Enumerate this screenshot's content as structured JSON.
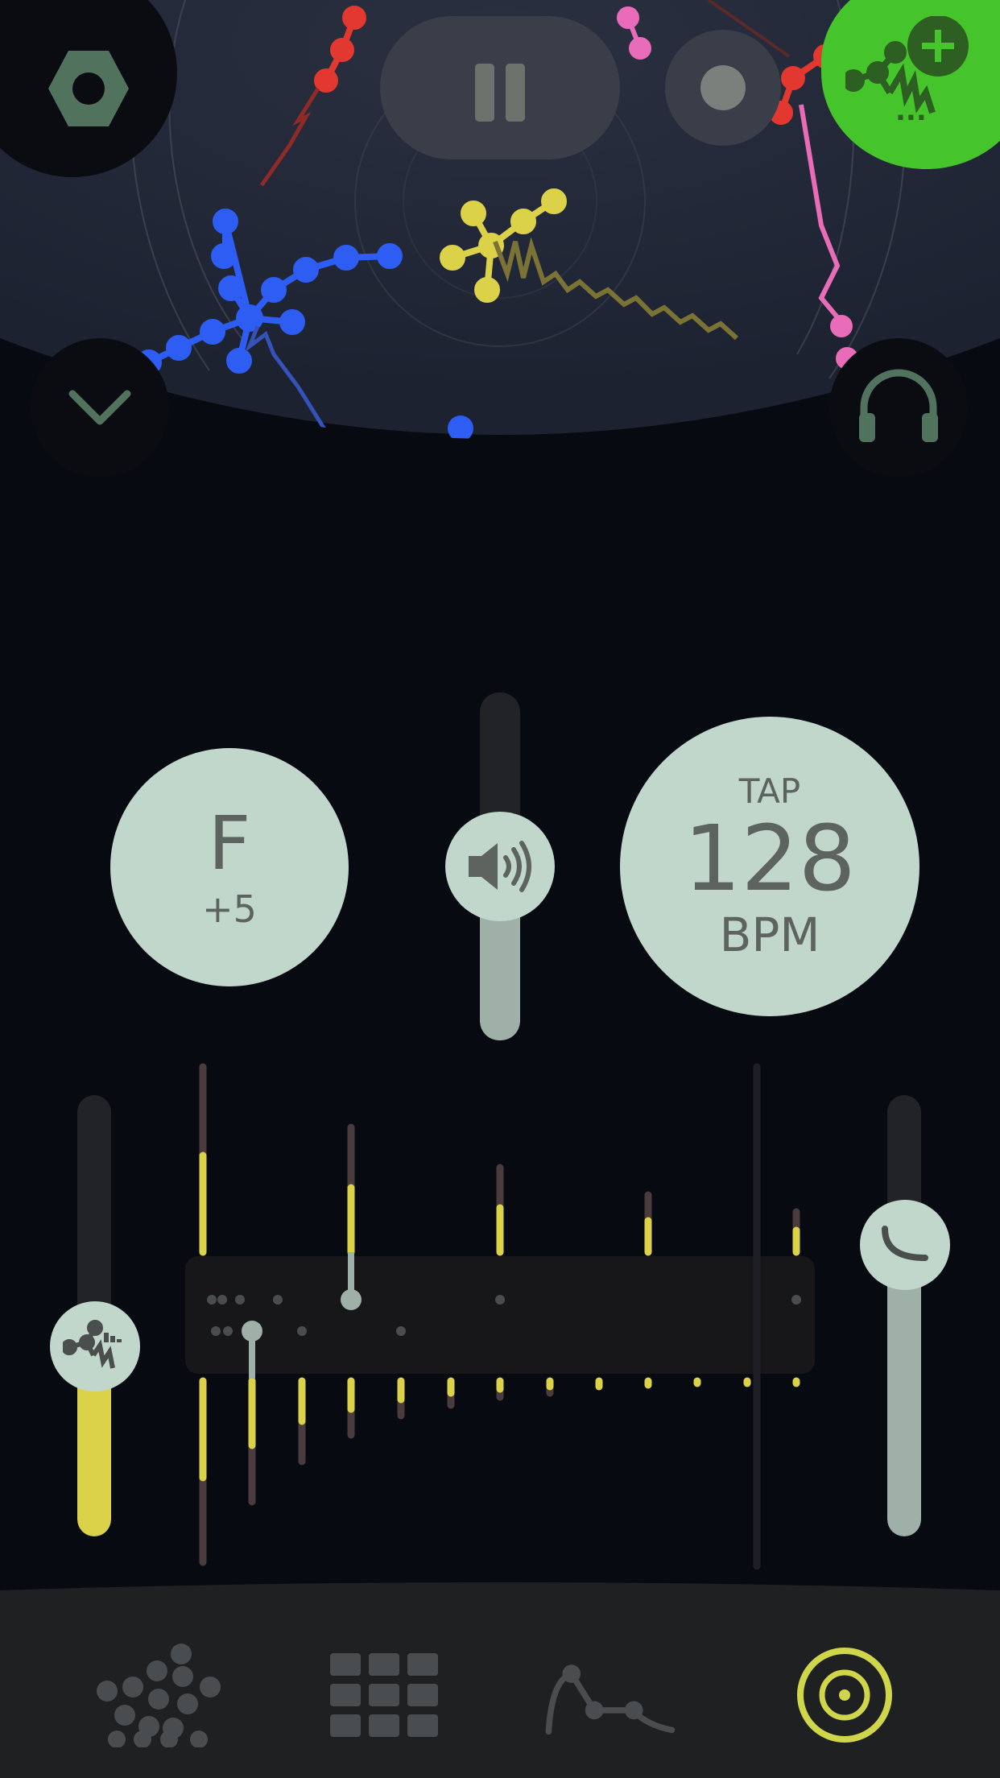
{
  "top_bar": {
    "settings_icon": "hexagon-nut-icon",
    "pause_icon": "pause-icon",
    "record_icon": "record-dot-icon",
    "add_icon": "add-molecule-icon",
    "more_label": "..."
  },
  "panel": {
    "collapse_icon": "chevron-down-icon",
    "headphones_icon": "headphones-icon"
  },
  "key": {
    "note": "F",
    "offset": "+5"
  },
  "tempo": {
    "tap_label": "TAP",
    "bpm_value": "128",
    "bpm_unit": "BPM"
  },
  "volume": {
    "icon": "speaker-icon",
    "level": 0.5
  },
  "left_slider": {
    "icon": "molecule-icon",
    "level": 0.43,
    "color": "#dcd24a"
  },
  "right_slider": {
    "icon": "curve-icon",
    "level": 0.66
  },
  "bottom_nav": [
    {
      "name": "molecules-tab",
      "icon": "dots-cluster-icon"
    },
    {
      "name": "grid-tab",
      "icon": "grid-icon"
    },
    {
      "name": "envelope-tab",
      "icon": "envelope-curve-icon"
    },
    {
      "name": "target-tab",
      "icon": "target-icon",
      "active": true,
      "color": "#cfd64a"
    }
  ],
  "colors": {
    "accent_green": "#45c52b",
    "knob": "#c2d7cb",
    "yellow": "#dcd24a",
    "blue": "#2d5df2",
    "red": "#e2382f",
    "pink": "#e86cb7"
  }
}
